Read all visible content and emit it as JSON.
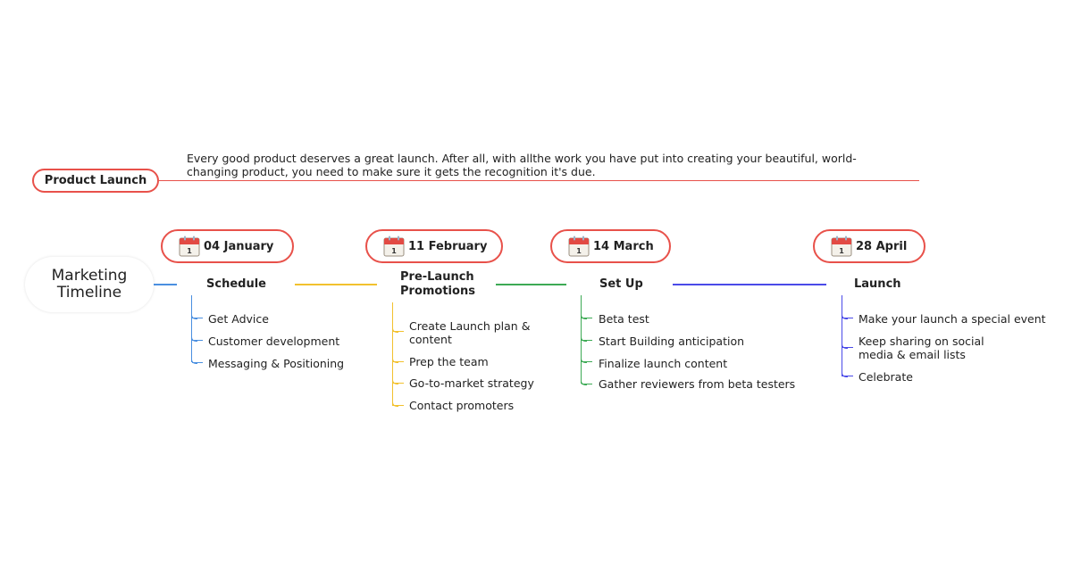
{
  "product_launch": {
    "label": "Product Launch",
    "description_line1": "Every good product deserves a great launch. After all, with allthe work you have put into creating your beautiful, world-",
    "description_line2": "changing product, you need to make sure it gets the recognition it's due."
  },
  "root": {
    "line1": "Marketing",
    "line2": "Timeline"
  },
  "calendar_icon_day": "1",
  "colors": {
    "accent_red": "#e8514a",
    "schedule": "#4a8fe0",
    "prelaunch": "#f2c12e",
    "setup": "#3daa55",
    "launch": "#4a4ae8"
  },
  "phases": [
    {
      "date": "04 January",
      "title": "Schedule",
      "items": [
        "Get Advice",
        "Customer development",
        "Messaging & Positioning"
      ]
    },
    {
      "date": "11 February",
      "title_line1": "Pre-Launch",
      "title_line2": "Promotions",
      "items": [
        "Create Launch plan &",
        "content",
        "Prep the team",
        "Go-to-market strategy",
        "Contact promoters"
      ]
    },
    {
      "date": "14 March",
      "title": "Set Up",
      "items": [
        "Beta test",
        "Start Building anticipation",
        "Finalize launch content",
        "Gather reviewers from beta testers"
      ]
    },
    {
      "date": "28 April",
      "title": "Launch",
      "items": [
        "Make your launch a special event",
        "Keep sharing on social",
        "media & email lists",
        "Celebrate"
      ]
    }
  ]
}
